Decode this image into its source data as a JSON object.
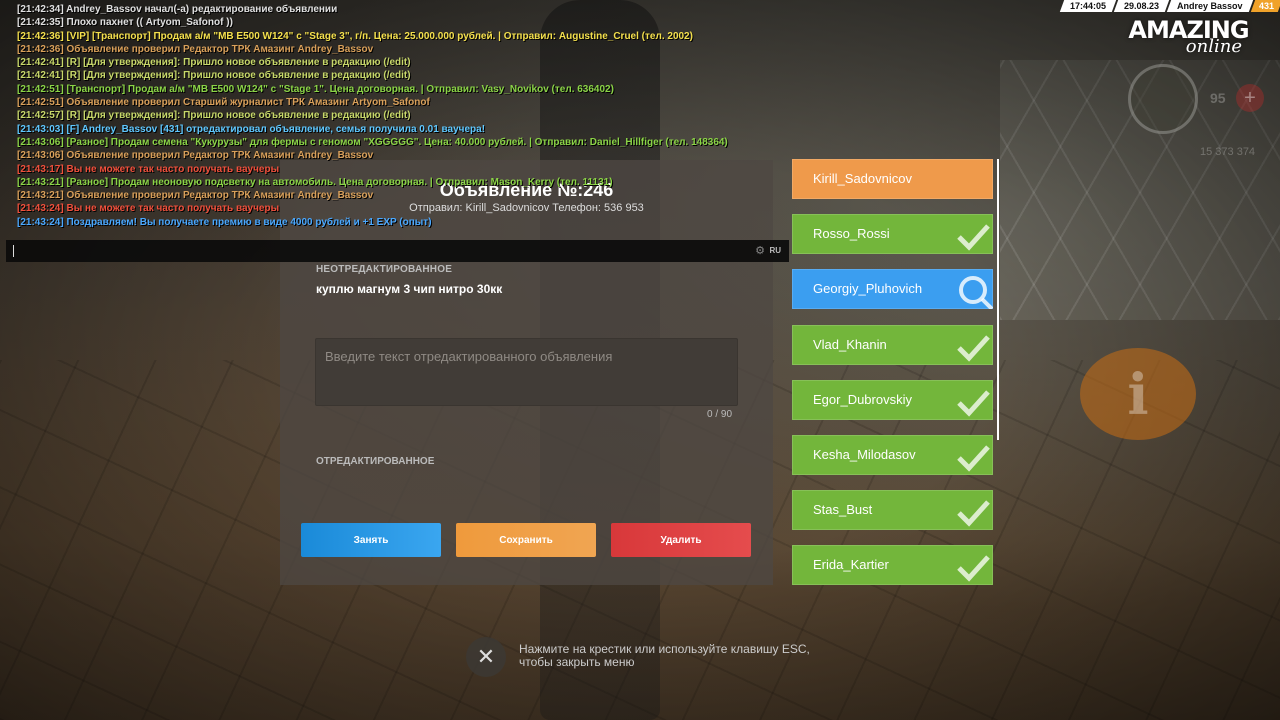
{
  "hud": {
    "time": "17:44:05",
    "date": "29.08.23",
    "player": "Andrey Bassov",
    "level": "431",
    "logo_main": "AMAZING",
    "logo_sub": "online",
    "hp": "95",
    "money": "15 373 374"
  },
  "chat": [
    {
      "text": "[21:42:34] Andrey_Bassov начал(-а) редактирование объявлении",
      "color": "#e0e0e0"
    },
    {
      "text": "[21:42:35] Плохо пахнет (( Artyom_Safonof ))",
      "color": "#e0e0e0"
    },
    {
      "text": "[21:42:36] [VIP] [Транспорт] Продам а/м \"MB E500 W124\" с \"Stage 3\", г/п. Цена: 25.000.000 рублей. | Отправил: Augustine_Cruel (тел. 2002)",
      "color": "#f4e04d"
    },
    {
      "text": "[21:42:36] Объявление проверил Редактор ТРК Амазинг Andrey_Bassov",
      "color": "#d9a05a"
    },
    {
      "text": "[21:42:41] [R] [Для утверждения]: Пришло новое объявление в редакцию (/edit)",
      "color": "#c8d86a"
    },
    {
      "text": "[21:42:41] [R] [Для утверждения]: Пришло новое объявление в редакцию (/edit)",
      "color": "#c8d86a"
    },
    {
      "text": "[21:42:51] [Транспорт] Продам а/м \"MB E500 W124\" с \"Stage 1\". Цена договорная. | Отправил: Vasy_Novikov (тел. 636402)",
      "color": "#8bd447"
    },
    {
      "text": "[21:42:51] Объявление проверил Старший журналист ТРК Амазинг Artyom_Safonof",
      "color": "#d9a05a"
    },
    {
      "text": "[21:42:57] [R] [Для утверждения]: Пришло новое объявление в редакцию (/edit)",
      "color": "#c8d86a"
    },
    {
      "text": "[21:43:03] [F] Andrey_Bassov [431] отредактировал объявление, семья получила 0.01 ваучера!",
      "color": "#5fc8ff"
    },
    {
      "text": "[21:43:06] [Разное] Продам семена \"Кукурузы\" для фермы с геномом \"XGGGGG\". Цена: 40.000 рублей. | Отправил: Daniel_Hillfiger (тел. 148364)",
      "color": "#8bd447"
    },
    {
      "text": "[21:43:06] Объявление проверил Редактор ТРК Амазинг Andrey_Bassov",
      "color": "#d9a05a"
    },
    {
      "text": "[21:43:17] Вы не можете так часто получать ваучеры",
      "color": "#f0503c"
    },
    {
      "text": "[21:43:21] [Разное] Продам неоновую подсветку на автомобиль. Цена договорная. | Отправил: Mason_Kerry (тел. 11131)",
      "color": "#8bd447"
    },
    {
      "text": "[21:43:21] Объявление проверил Редактор ТРК Амазинг Andrey_Bassov",
      "color": "#d9a05a"
    },
    {
      "text": "[21:43:24] Вы не можете так часто получать ваучеры",
      "color": "#f0503c"
    },
    {
      "text": "[21:43:24] Поздравляем! Вы получаете премию в виде 4000 рублей и +1 EXP (опыт)",
      "color": "#4aa8ff"
    }
  ],
  "chat_input": {
    "lang": "RU"
  },
  "panel": {
    "title": "Объявление №:246",
    "sender": "Отправил: Kirill_Sadovnicov Телефон: 536 953",
    "label_unedited": "НЕОТРЕДАКТИРОВАННОЕ",
    "original_text": "куплю магнум 3 чип нитро 30кк",
    "edit_placeholder": "Введите текст отредактированного объявления",
    "counter": "0 / 90",
    "label_edited": "ОТРЕДАКТИРОВАННОЕ",
    "btn_take": "Занять",
    "btn_save": "Сохранить",
    "btn_delete": "Удалить"
  },
  "queue": [
    {
      "name": "Kirill_Sadovnicov",
      "state": "orange",
      "icon": "none"
    },
    {
      "name": "Rosso_Rossi",
      "state": "green",
      "icon": "check-icon"
    },
    {
      "name": "Georgiy_Pluhovich",
      "state": "blue",
      "icon": "magnifier-icon"
    },
    {
      "name": "Vlad_Khanin",
      "state": "green",
      "icon": "check-icon"
    },
    {
      "name": "Egor_Dubrovskiy",
      "state": "green",
      "icon": "check-icon"
    },
    {
      "name": "Kesha_Milodasov",
      "state": "green",
      "icon": "check-icon"
    },
    {
      "name": "Stas_Bust",
      "state": "green",
      "icon": "check-icon"
    },
    {
      "name": "Erida_Kartier",
      "state": "green",
      "icon": "check-icon"
    }
  ],
  "close": {
    "hint_line1": "Нажмите на крестик или используйте клавишу ESC,",
    "hint_line2": "чтобы закрыть меню"
  }
}
